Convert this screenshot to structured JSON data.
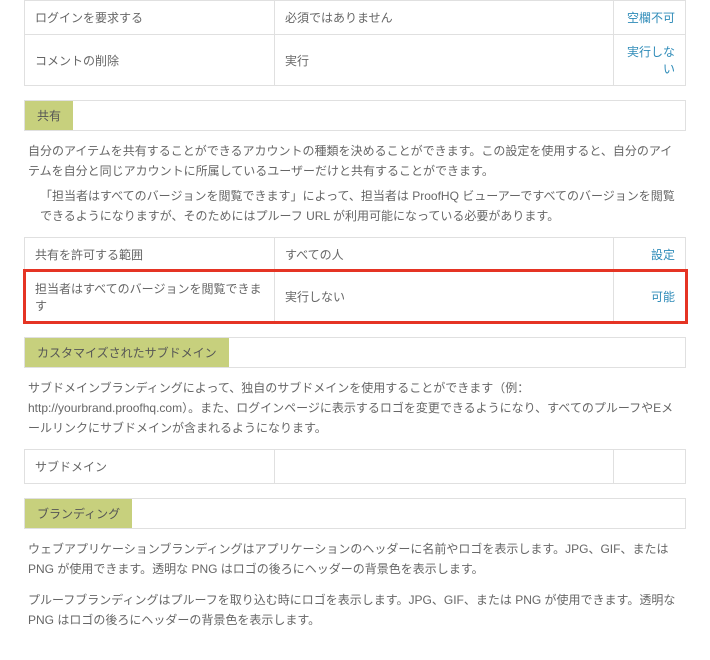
{
  "top_rows": [
    {
      "label": "ログインを要求する",
      "value": "必須ではありません",
      "action": "空欄不可"
    },
    {
      "label": "コメントの削除",
      "value": "実行",
      "action": "実行しない"
    }
  ],
  "sharing": {
    "title": "共有",
    "desc_main": "自分のアイテムを共有することができるアカウントの種類を決めることができます。この設定を使用すると、自分のアイテムを自分と同じアカウントに所属しているユーザーだけと共有することができます。",
    "desc_indent": "「担当者はすべてのバージョンを閲覧できます」によって、担当者は ProofHQ ビューアーですべてのバージョンを閲覧できるようになりますが、そのためにはプルーフ URL が利用可能になっている必要があります。",
    "rows": [
      {
        "label": "共有を許可する範囲",
        "value": "すべての人",
        "action": "設定"
      },
      {
        "label": "担当者はすべてのバージョンを閲覧できます",
        "value": "実行しない",
        "action": "可能",
        "highlight": true
      }
    ]
  },
  "subdomain": {
    "title": "カスタマイズされたサブドメイン",
    "desc": "サブドメインブランディングによって、独自のサブドメインを使用することができます（例：http://yourbrand.proofhq.com）。また、ログインページに表示するロゴを変更できるようになり、すべてのプルーフやEメールリンクにサブドメインが含まれるようになります。",
    "row_label": "サブドメイン"
  },
  "branding": {
    "title": "ブランディング",
    "desc1": "ウェブアプリケーションブランディングはアプリケーションのヘッダーに名前やロゴを表示します。JPG、GIF、または PNG が使用できます。透明な PNG はロゴの後ろにヘッダーの背景色を表示します。",
    "desc2": "プルーフブランディングはプルーフを取り込む時にロゴを表示します。JPG、GIF、または PNG が使用できます。透明な PNG はロゴの後ろにヘッダーの背景色を表示します。"
  }
}
